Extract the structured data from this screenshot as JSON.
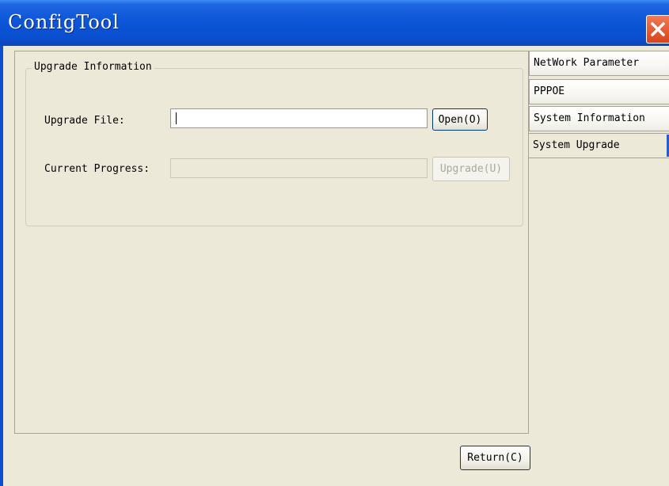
{
  "window": {
    "title": "ConfigTool"
  },
  "group": {
    "title": "Upgrade Information",
    "file_label": "Upgrade File:",
    "file_value": "",
    "open_button": "Open(O)",
    "progress_label": "Current Progress:",
    "progress": 0,
    "upgrade_button": "Upgrade(U)"
  },
  "tabs": [
    {
      "label": "NetWork Parameter"
    },
    {
      "label": "PPPOE"
    },
    {
      "label": "System Information"
    },
    {
      "label": "System Upgrade",
      "active": true
    }
  ],
  "footer": {
    "return_button": "Return(C)"
  },
  "colors": {
    "titlebar": "#0b56d8",
    "close": "#d8431c",
    "background": "#ece9d8",
    "tab_accent": "#2a5cd0"
  },
  "icons": {
    "close": "close-icon"
  }
}
